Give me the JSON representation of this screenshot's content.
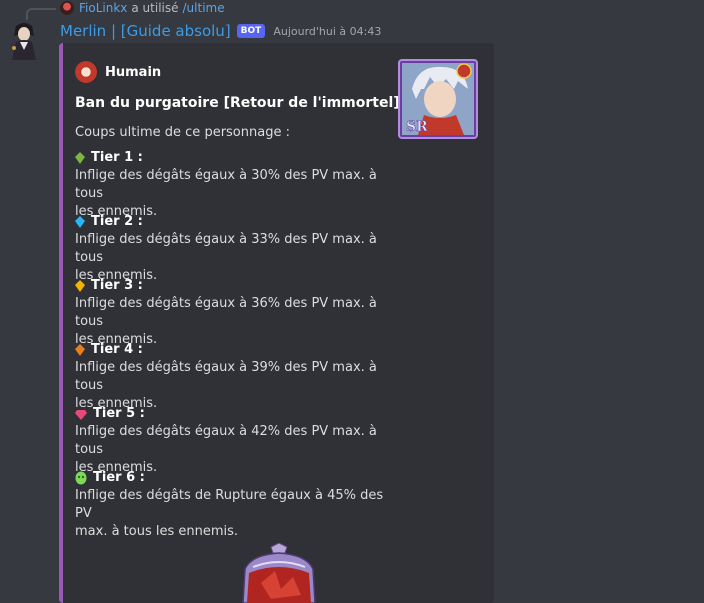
{
  "reply": {
    "user": "FioLinkx",
    "action": "a utilisé",
    "command": "/ultime"
  },
  "message": {
    "author": "Merlin | [Guide absolu]",
    "tag": "BOT",
    "timestamp": "Aujourd'hui à 04:43"
  },
  "embed": {
    "accent_color": "#9b59b6",
    "author": "Humain",
    "title": "Ban du purgatoire [Retour de l'immortel]",
    "description": "Coups ultime de ce personnage :",
    "fields": [
      {
        "name": "Tier 1 :",
        "icon": "green-gem-icon",
        "color": "#7cb342",
        "line1": "Inflige des dégâts égaux à 30% des PV max. à tous",
        "line2": "les ennemis."
      },
      {
        "name": "Tier 2 :",
        "icon": "blue-gem-icon",
        "color": "#29b6f6",
        "line1": "Inflige des dégâts égaux à 33% des PV max. à tous",
        "line2": "les ennemis."
      },
      {
        "name": "Tier 3 :",
        "icon": "gold-gem-icon",
        "color": "#f4b400",
        "line1": "Inflige des dégâts égaux à 36% des PV max. à tous",
        "line2": "les ennemis."
      },
      {
        "name": "Tier 4 :",
        "icon": "orange-gem-icon",
        "color": "#e67e22",
        "line1": "Inflige des dégâts égaux à 39% des PV max. à tous",
        "line2": "les ennemis."
      },
      {
        "name": "Tier 5 :",
        "icon": "pink-gem-icon",
        "color": "#e84a78",
        "line1": "Inflige des dégâts égaux à 42% des PV max. à tous",
        "line2": "les ennemis."
      },
      {
        "name": "Tier 6 :",
        "icon": "green-skull-gem-icon",
        "color": "#7ed957",
        "line1": "Inflige des dégâts de Rupture égaux à 45% des PV",
        "line2": "max. à tous les ennemis."
      }
    ]
  }
}
